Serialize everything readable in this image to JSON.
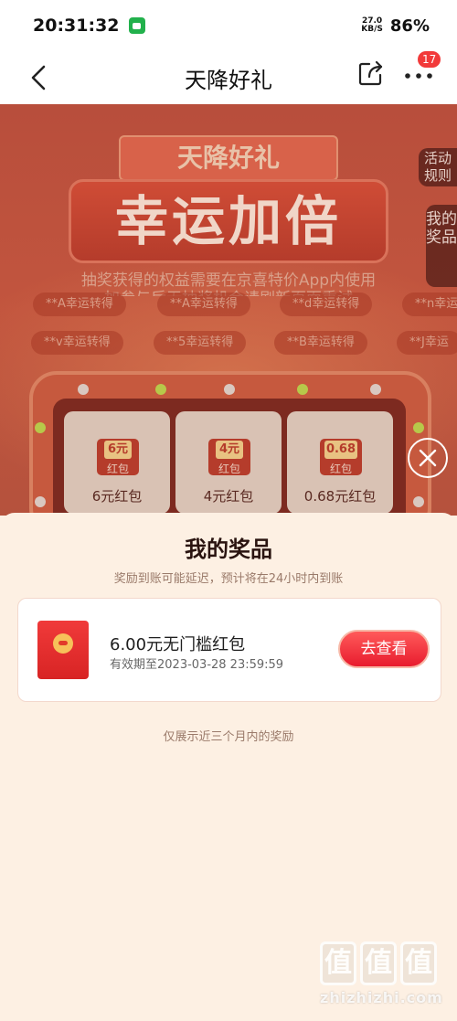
{
  "status_bar": {
    "time": "20:31:32",
    "net_speed": "27.0",
    "net_unit": "KB/S",
    "battery": "86%"
  },
  "nav": {
    "title": "天降好礼",
    "badge_count": "17"
  },
  "hero": {
    "sub_title": "天降好礼",
    "main_title": "幸运加倍",
    "desc": "抽奖获得的权益需要在京喜特价App内使用",
    "desc2": "加参与后无抽奖机会请刷新页面重试",
    "tickers_row1": [
      "**A幸运转得",
      "**A幸运转得",
      "**d幸运转得",
      "**n幸运"
    ],
    "tickers_row2": [
      "**v幸运转得",
      "**5幸运转得",
      "**B幸运转得",
      "**J幸运"
    ],
    "rules_tab": "活动规则",
    "my_prizes_tab": "我的奖品",
    "prizes": [
      {
        "amount": "6元",
        "env_label": "红包",
        "name": "6元红包"
      },
      {
        "amount": "4元",
        "env_label": "红包",
        "name": "4元红包"
      },
      {
        "amount": "0.68",
        "env_label": "红包",
        "name": "0.68元红包"
      }
    ]
  },
  "sheet": {
    "title": "我的奖品",
    "note": "奖励到账可能延迟，预计将在24小时内到账",
    "reward": {
      "amount": "6.00元无门槛红包",
      "expiry": "有效期至2023-03-28 23:59:59",
      "button": "去查看"
    },
    "footer": "仅展示近三个月内的奖励"
  },
  "watermark": {
    "logo_char": "值",
    "text": "zhizhizhi.com"
  }
}
